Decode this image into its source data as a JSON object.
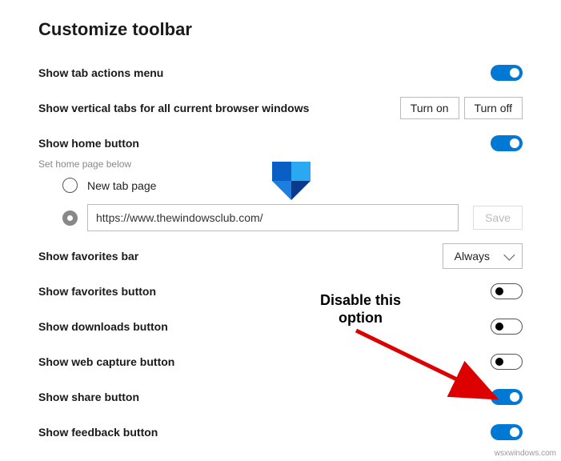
{
  "page": {
    "title": "Customize toolbar"
  },
  "rows": {
    "tab_actions": {
      "label": "Show tab actions menu",
      "toggle": "on"
    },
    "vertical_tabs": {
      "label": "Show vertical tabs for all current browser windows",
      "on_btn": "Turn on",
      "off_btn": "Turn off"
    },
    "home_button": {
      "label": "Show home button",
      "subtext": "Set home page below",
      "toggle": "on"
    },
    "home_radio": {
      "new_tab_label": "New tab page",
      "url_value": "https://www.thewindowsclub.com/",
      "save_label": "Save"
    },
    "favorites_bar": {
      "label": "Show favorites bar",
      "dropdown": "Always"
    },
    "favorites_btn": {
      "label": "Show favorites button",
      "toggle": "off"
    },
    "downloads_btn": {
      "label": "Show downloads button",
      "toggle": "off"
    },
    "web_capture_btn": {
      "label": "Show web capture button",
      "toggle": "off"
    },
    "share_btn": {
      "label": "Show share button",
      "toggle": "on"
    },
    "feedback_btn": {
      "label": "Show feedback button",
      "toggle": "on"
    }
  },
  "annotation": {
    "line1": "Disable this",
    "line2": "option"
  },
  "watermark": "wsxwindows.com"
}
